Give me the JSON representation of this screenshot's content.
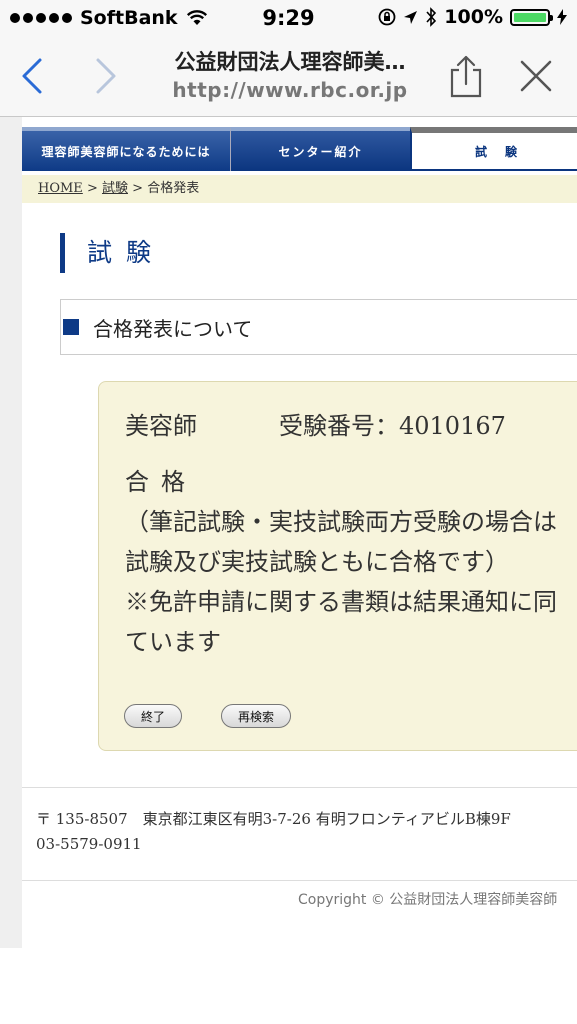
{
  "status": {
    "carrier": "SoftBank",
    "time": "9:29",
    "battery": "100%",
    "colors": {
      "battery_fill": "#4cd964"
    }
  },
  "browser": {
    "title": "公益財団法人理容師美…",
    "url": "http://www.rbc.or.jp",
    "icons": [
      "back-icon",
      "forward-icon",
      "share-icon",
      "close-icon"
    ]
  },
  "nav": {
    "tabs": [
      {
        "label": "理容師美容師になるためには"
      },
      {
        "label": "センター紹介"
      },
      {
        "label": "試験"
      }
    ],
    "active_tab": "試験"
  },
  "breadcrumb": {
    "home": "HOME",
    "sep": ">",
    "exam": "試験",
    "current": "合格発表"
  },
  "page": {
    "heading": "試験",
    "section_title": "合格発表について"
  },
  "result": {
    "job": "美容師",
    "exam_number": "受験番号：4010167",
    "status": "合格",
    "note_line1": "（筆記試験・実技試験両方受験の場合は",
    "note_line2": "試験及び実技試験ともに合格です）",
    "note_line3": "※免許申請に関する書類は結果通知に同",
    "note_line4": "ています",
    "buttons": {
      "end": "終了",
      "research": "再検索"
    }
  },
  "footer": {
    "address": "〒 135-8507　東京都江東区有明3-7-26 有明フロンティアビルB棟9F",
    "phone": "03-5579-0911",
    "copyright": "Copyright © 公益財団法人理容師美容師"
  },
  "colors": {
    "brand_blue": "#0e3a86",
    "breadcrumb_bg": "#f5f3d8",
    "result_bg": "#f7f4dc"
  }
}
